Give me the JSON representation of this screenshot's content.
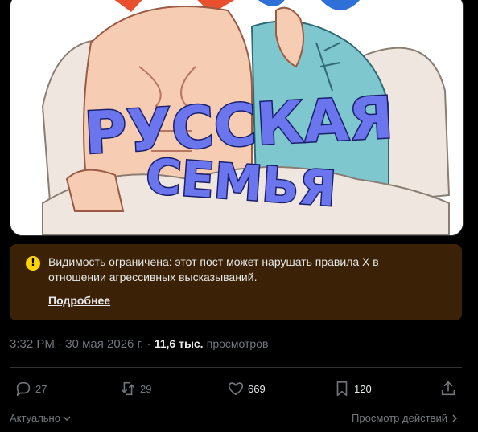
{
  "media": {
    "caption_line1": "РУССКАЯ",
    "caption_line2": "СЕМЬЯ"
  },
  "notice": {
    "icon": "exclamation-icon",
    "text": "Видимость ограничена: этот пост может нарушать правила X в отношении агрессивных высказываний.",
    "link_label": "Подробнее",
    "background": "#3b2106",
    "icon_color": "#ffd400"
  },
  "meta": {
    "time": "3:32 PM",
    "separator": "·",
    "date": "30 мая 2026 г.",
    "views_count": "11,6 тыс.",
    "views_label": "просмотров"
  },
  "actions": {
    "replies": "27",
    "reposts": "29",
    "likes": "669",
    "bookmarks": "120"
  },
  "footer": {
    "sort_label": "Актуально",
    "activity_label": "Просмотр действий"
  }
}
